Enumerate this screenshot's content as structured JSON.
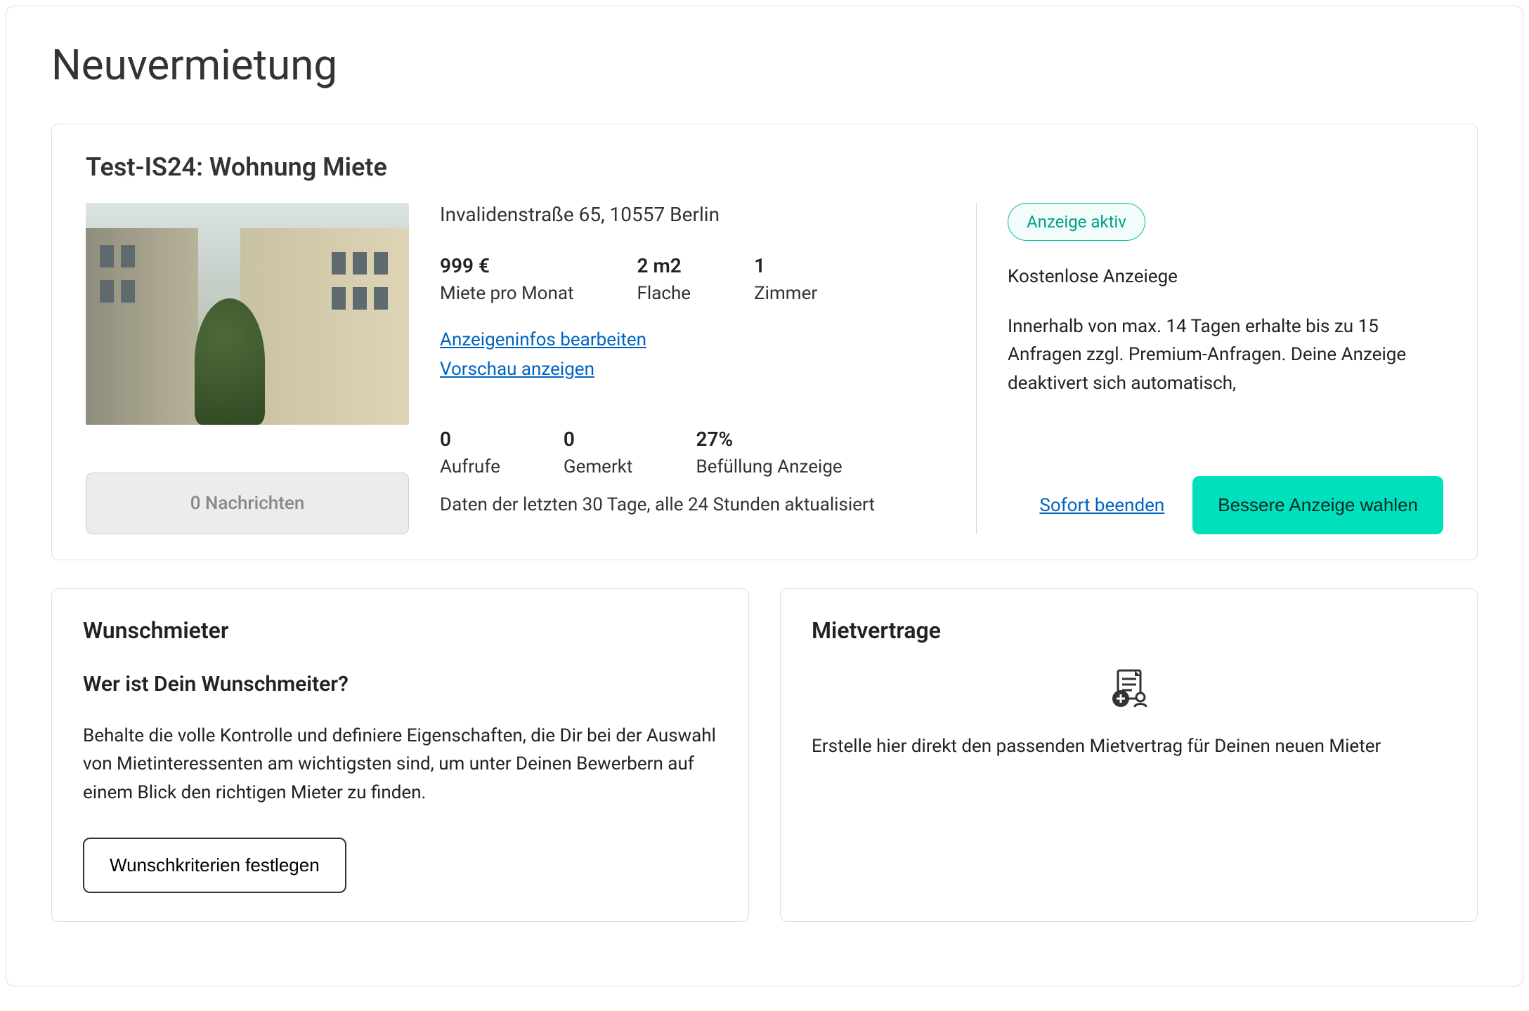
{
  "page": {
    "title": "Neuvermietung"
  },
  "listing": {
    "title": "Test-IS24: Wohnung Miete",
    "address": "Invalidenstraße 65, 10557 Berlin",
    "facts": {
      "price": {
        "value": "999 €",
        "label": "Miete pro Monat"
      },
      "area": {
        "value": "2 m2",
        "label": "Flache"
      },
      "rooms": {
        "value": "1",
        "label": "Zimmer"
      }
    },
    "links": {
      "edit": "Anzeigeninfos bearbeiten",
      "preview": "Vorschau anzeigen"
    },
    "messages_button": "0 Nachrichten",
    "stats": {
      "views": {
        "value": "0",
        "label": "Aufrufe"
      },
      "saved": {
        "value": "0",
        "label": "Gemerkt"
      },
      "fill": {
        "value": "27%",
        "label": "Befüllung Anzeige"
      }
    },
    "stats_caption": "Daten der letzten 30 Tage, alle 24 Stunden aktualisiert",
    "status": {
      "pill": "Anzeige aktiv",
      "heading": "Kostenlose Anzeiege",
      "body": "Innerhalb von max. 14 Tagen erhalte bis zu 15 Anfragen  zzgl. Premium-Anfragen. Deine Anzeige deaktivert sich automatisch,",
      "actions": {
        "end": "Sofort beenden",
        "upgrade": "Bessere Anzeige wahlen"
      }
    }
  },
  "wunschmieter": {
    "title": "Wunschmieter",
    "subtitle": "Wer ist Dein Wunschmeiter?",
    "body": "Behalte die volle Kontrolle und definiere Eigenschaften, die Dir bei der Auswahl von Mietinteressenten am wichtigsten sind, um unter Deinen Bewerbern auf einem Blick den richtigen Mieter zu finden.",
    "button": "Wunschkriterien festlegen"
  },
  "mietvertrage": {
    "title": "Mietvertrage",
    "body": "Erstelle hier direkt den passenden Mietvertrag für Deinen neuen Mieter"
  }
}
